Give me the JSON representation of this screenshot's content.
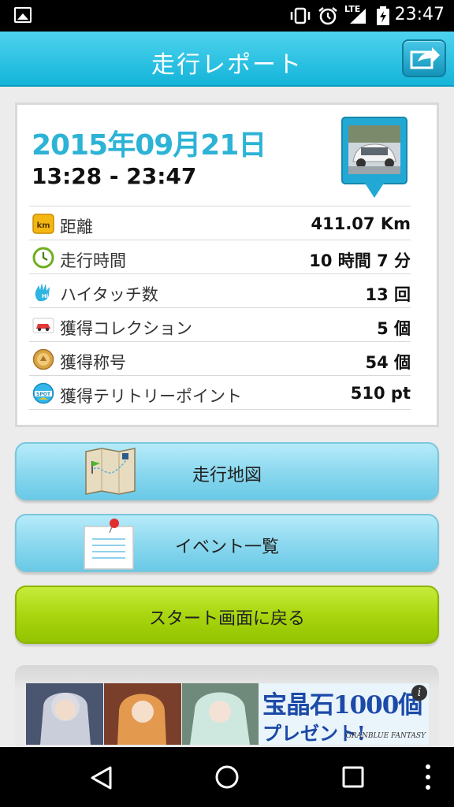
{
  "status_bar": {
    "time": "23:47",
    "network": "LTE",
    "icons": [
      "gallery-icon",
      "vibrate-icon",
      "alarm-icon",
      "signal-icon",
      "battery-charging-icon"
    ]
  },
  "header": {
    "title": "走行レポート",
    "share_icon": "share-icon"
  },
  "report": {
    "date": "2015年09月21日",
    "time_range": "13:28 - 23:47",
    "rows": [
      {
        "icon": "km-icon",
        "label": "距離",
        "value": "411.07 Km"
      },
      {
        "icon": "clock-icon",
        "label": "走行時間",
        "value": "10 時間 7 分"
      },
      {
        "icon": "hi-touch-icon",
        "label": "ハイタッチ数",
        "value": "13 回"
      },
      {
        "icon": "car-collection-icon",
        "label": "獲得コレクション",
        "value": "5 個"
      },
      {
        "icon": "title-medal-icon",
        "label": "獲得称号",
        "value": "54 個"
      },
      {
        "icon": "spot-icon",
        "label": "獲得テリトリーポイント",
        "value": "510 pt"
      }
    ]
  },
  "buttons": {
    "map": "走行地図",
    "events": "イベント一覧",
    "back_to_start": "スタート画面に戻る"
  },
  "ad": {
    "line1": "宝晶石1000個",
    "line2": "プレゼント!",
    "brand": "GRANBLUE FANTASY",
    "info": "i"
  },
  "nav": {
    "icons": [
      "back-icon",
      "home-icon",
      "recents-icon",
      "overflow-menu-icon"
    ]
  },
  "colors": {
    "header": "#14b4d9",
    "date": "#2cb3d6",
    "blue_button": "#8dd9ef",
    "green_button": "#a9d60f"
  }
}
